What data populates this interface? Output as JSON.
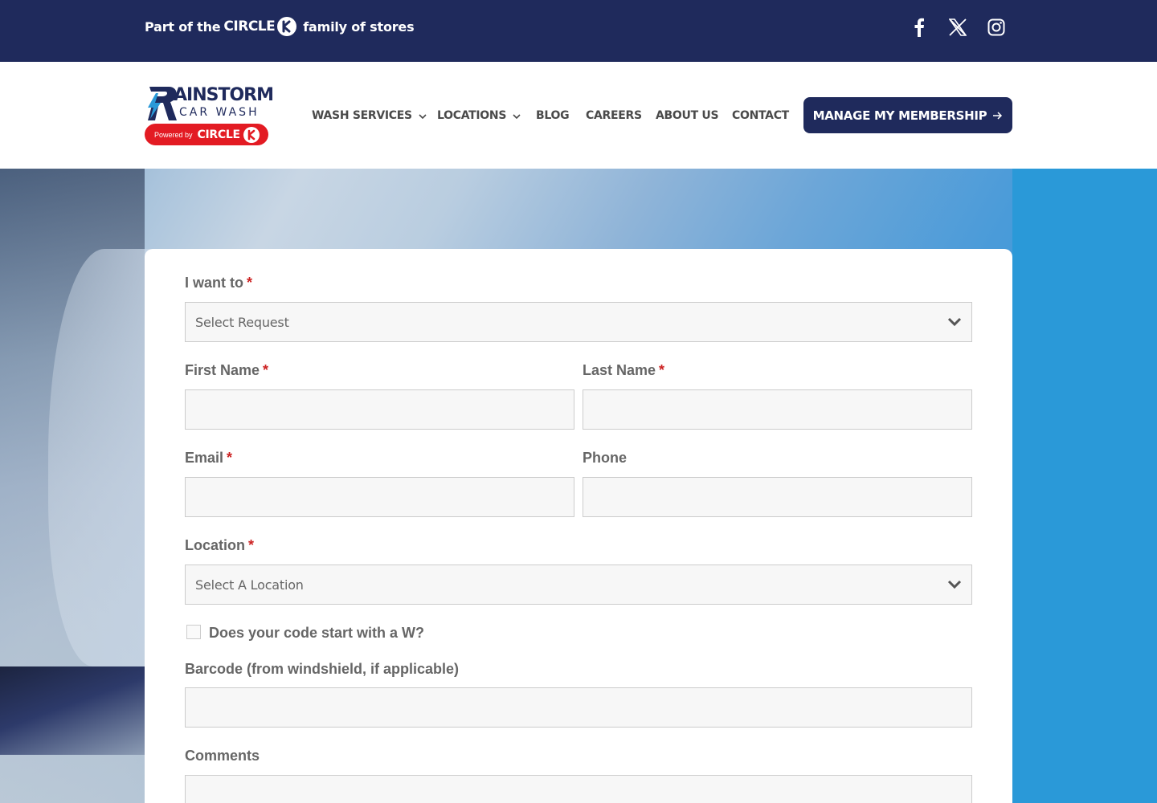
{
  "topbar": {
    "family_prefix": "Part of the",
    "family_brand": "CIRCLE",
    "family_suffix": "family of stores",
    "social": [
      "facebook-icon",
      "x-icon",
      "instagram-icon"
    ]
  },
  "logo": {
    "brand_top": "AINSTORM",
    "brand_bottom": "CAR WASH",
    "powered_by": "Powered by",
    "powered_brand": "CIRCLE"
  },
  "nav": {
    "items": [
      "WASH SERVICES",
      "LOCATIONS",
      "BLOG",
      "CAREERS",
      "ABOUT US",
      "CONTACT"
    ],
    "cta": "MANAGE MY MEMBERSHIP"
  },
  "form": {
    "request_label": "I want to",
    "request_placeholder": "Select Request",
    "first_name_label": "First Name",
    "last_name_label": "Last Name",
    "email_label": "Email",
    "phone_label": "Phone",
    "location_label": "Location",
    "location_placeholder": "Select A Location",
    "code_question": "Does your code start with a W?",
    "barcode_label": "Barcode (from windshield, if applicable)",
    "comments_label": "Comments",
    "required_mark": "*"
  },
  "colors": {
    "navy": "#1f2a5c",
    "brand_red": "#e31b23",
    "hero_blue": "#2a99d8",
    "label_gray": "#666666",
    "required_red": "#cc2222"
  }
}
